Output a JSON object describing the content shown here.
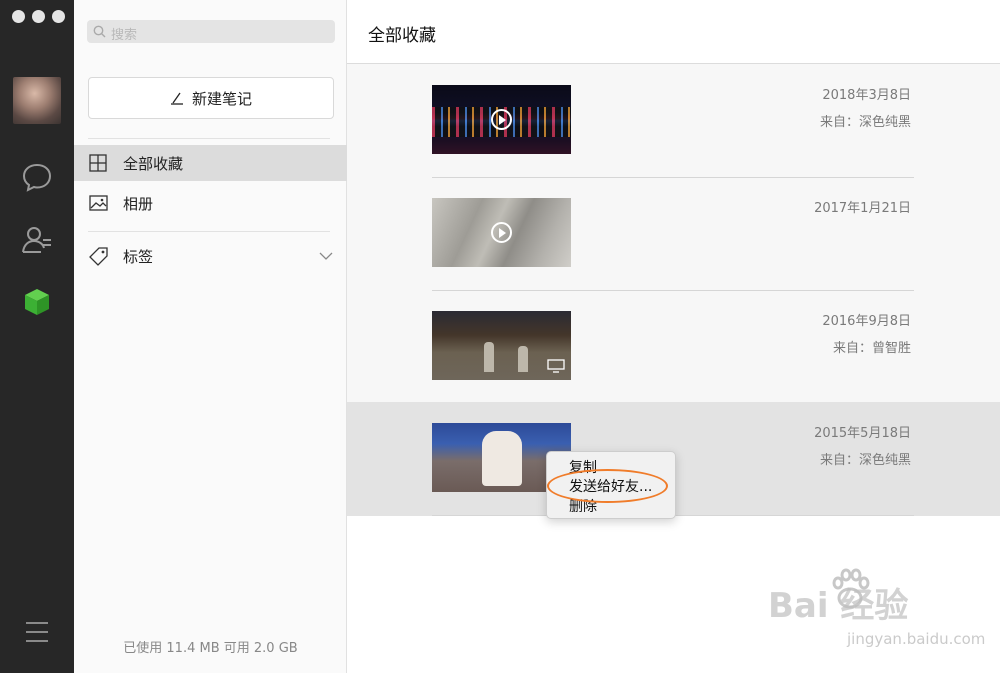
{
  "sidebar": {
    "search_placeholder": "搜索",
    "new_note_label": "新建笔记",
    "nav": [
      {
        "label": "全部收藏",
        "icon": "grid-icon",
        "active": true
      },
      {
        "label": "相册",
        "icon": "photo-icon",
        "active": false
      },
      {
        "label": "标签",
        "icon": "tag-icon",
        "active": false
      }
    ],
    "storage": "已使用 11.4 MB 可用 2.0 GB"
  },
  "rail": {
    "icons": [
      "chat-icon",
      "contacts-icon",
      "favorites-cube-icon",
      "menu-icon"
    ],
    "accent": "#3cb034"
  },
  "main": {
    "title": "全部收藏",
    "items": [
      {
        "date": "2018年3月8日",
        "source": "来自：深色纯黑",
        "type": "video"
      },
      {
        "date": "2017年1月21日",
        "source": "",
        "type": "video"
      },
      {
        "date": "2016年9月8日",
        "source": "来自：曾智胜",
        "type": "screen-video"
      },
      {
        "date": "2015年5月18日",
        "source": "来自：深色纯黑",
        "type": "image",
        "selected": true
      }
    ]
  },
  "context_menu": {
    "items": [
      "复制",
      "发送给好友...",
      "删除"
    ],
    "highlight_color": "#f07c2a"
  },
  "watermark": {
    "brand": "Bai 经验",
    "url": "jingyan.baidu.com"
  }
}
